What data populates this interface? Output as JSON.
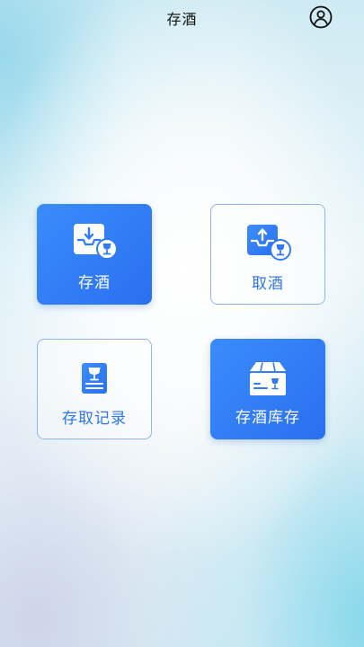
{
  "header": {
    "title": "存酒",
    "profile_icon": "user-profile-icon"
  },
  "tiles": [
    {
      "label": "存酒",
      "icon": "deposit-tray-wine-icon",
      "style": "filled"
    },
    {
      "label": "取酒",
      "icon": "withdraw-tray-wine-icon",
      "style": "outline"
    },
    {
      "label": "存取记录",
      "icon": "record-book-wine-icon",
      "style": "outline"
    },
    {
      "label": "存酒库存",
      "icon": "inventory-box-wine-icon",
      "style": "filled"
    }
  ],
  "colors": {
    "primary_blue": "#2f7bf5",
    "outline_border": "#8fb6ea",
    "title_text": "#111111"
  }
}
